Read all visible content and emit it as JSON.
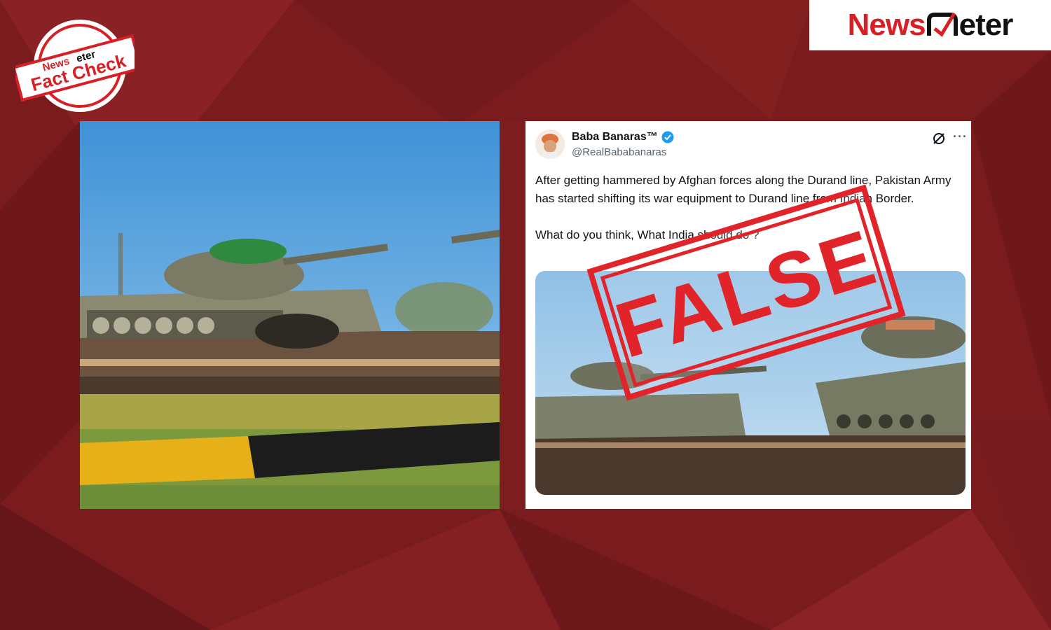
{
  "brand": {
    "logo_news": "News",
    "logo_meter": "eter",
    "badge_top": "News",
    "badge_top_meter": "eter",
    "badge_main": "Fact Check"
  },
  "tweet": {
    "display_name": "Baba Banaras™",
    "handle": "@RealBababanaras",
    "paragraphs": [
      "After getting hammered by Afghan forces along the Durand line, Pakistan Army has started shifting its war equipment to Durand line from Indian Border.",
      "What do you think, What India should do ?"
    ]
  },
  "verdict": "FALSE",
  "icons": [
    "verified-badge-icon",
    "grok-icon",
    "more-options-icon"
  ],
  "colors": {
    "background": "#7a1b1e",
    "brand_red": "#d71f26",
    "stamp_red": "#e0242a",
    "verified_blue": "#1d9bf0"
  }
}
